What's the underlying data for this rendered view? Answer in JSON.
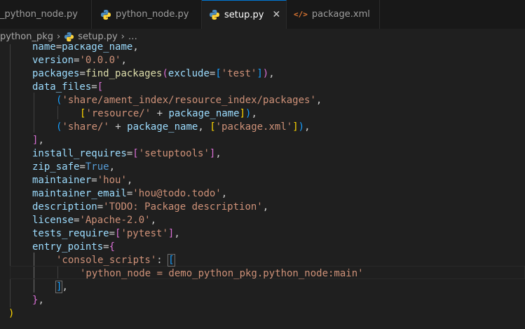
{
  "tabs": [
    {
      "label": "_python_node.py",
      "icon": "python-icon"
    },
    {
      "label": "python_node.py",
      "icon": "python-icon"
    },
    {
      "label": "setup.py",
      "icon": "python-icon",
      "active": true,
      "close": "✕"
    },
    {
      "label": "package.xml",
      "icon": "xml-icon",
      "icon_text": "</>"
    }
  ],
  "breadcrumb": {
    "folder": "python_pkg",
    "file": "setup.py",
    "more": "…"
  },
  "code": [
    {
      "name": "name",
      "eq": "=",
      "value": "package_name",
      "end": ","
    },
    {
      "name": "version",
      "eq": "=",
      "str": "'0.0.0'",
      "end": ","
    },
    {
      "name": "packages",
      "eq": "=",
      "func": "find_packages",
      "open": "(",
      "arg": "exclude",
      "eq2": "=",
      "lb": "[",
      "str": "'test'",
      "rb": "]",
      "close": ")",
      "end": ","
    },
    {
      "name": "data_files",
      "eq": "=",
      "open": "["
    },
    {
      "open": "(",
      "str": "'share/ament_index/resource_index/packages'",
      "end": ","
    },
    {
      "lb": "[",
      "str": "'resource/'",
      "plus": " + ",
      "value": "package_name",
      "rb": "]",
      "close": ")",
      "end": ","
    },
    {
      "open": "(",
      "str": "'share/'",
      "plus": " + ",
      "value": "package_name",
      "comma": ", ",
      "lb": "[",
      "str2": "'package.xml'",
      "rb": "]",
      "close": ")",
      "end": ","
    },
    {
      "close": "]",
      "end": ","
    },
    {
      "name": "install_requires",
      "eq": "=",
      "lb": "[",
      "str": "'setuptools'",
      "rb": "]",
      "end": ","
    },
    {
      "name": "zip_safe",
      "eq": "=",
      "const": "True",
      "end": ","
    },
    {
      "name": "maintainer",
      "eq": "=",
      "str": "'hou'",
      "end": ","
    },
    {
      "name": "maintainer_email",
      "eq": "=",
      "str": "'hou@todo.todo'",
      "end": ","
    },
    {
      "name": "description",
      "eq": "=",
      "str": "'TODO: Package description'",
      "end": ","
    },
    {
      "name": "license",
      "eq": "=",
      "str": "'Apache-2.0'",
      "end": ","
    },
    {
      "name": "tests_require",
      "eq": "=",
      "lb": "[",
      "str": "'pytest'",
      "rb": "]",
      "end": ","
    },
    {
      "name": "entry_points",
      "eq": "=",
      "open": "{"
    },
    {
      "str": "'console_scripts'",
      "colon": ": ",
      "lb": "["
    },
    {
      "str": "'python_node = demo_python_pkg.python_node:main'"
    },
    {
      "rb": "]",
      "end": ","
    },
    {
      "close": "}",
      "end": ","
    },
    {
      "close": ")"
    }
  ],
  "colors": {
    "background": "#1f1f1f",
    "tabbar": "#181818",
    "accent": "#0078d4",
    "string": "#ce9178",
    "param": "#9cdcfe",
    "function": "#dcdcaa",
    "constant": "#569cd6"
  }
}
